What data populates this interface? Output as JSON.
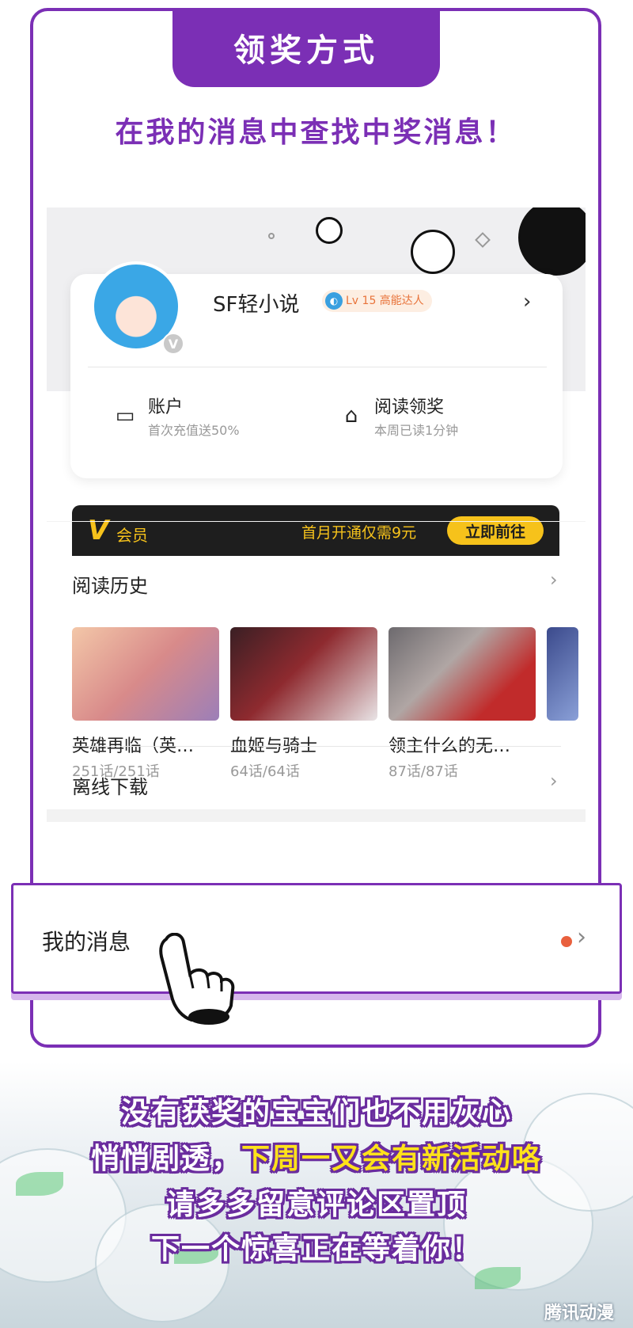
{
  "header": {
    "title": "领奖方式",
    "subtitle": "在我的消息中查找中奖消息！"
  },
  "profile": {
    "avatar_badge": "V",
    "username": "SF轻小说",
    "level_badge": "Lv 15 高能达人",
    "account": {
      "label": "账户",
      "sub": "首次充值送50%"
    },
    "reading_reward": {
      "label": "阅读领奖",
      "sub": "本周已读1分钟"
    }
  },
  "vip": {
    "logo": "V",
    "label": "会员",
    "promo": "首月开通仅需9元",
    "cta": "立即前往"
  },
  "history": {
    "title": "阅读历史",
    "books": [
      {
        "title": "英雄再临（英…",
        "count": "251话/251话",
        "cover_color": "#d88a8a"
      },
      {
        "title": "血姬与骑士",
        "count": "64话/64话",
        "cover_color": "#8e2a2f"
      },
      {
        "title": "领主什么的无…",
        "count": "87话/87话",
        "cover_color": "#6d6a6e"
      }
    ]
  },
  "offline": {
    "title": "离线下载"
  },
  "messages": {
    "title": "我的消息"
  },
  "bottom": {
    "line1": "没有获奖的宝宝们也不用灰心",
    "line2_a": "悄悄剧透，",
    "line2_b": "下周一又会有新活动咯",
    "line3": "请多多留意评论区置顶",
    "line4": "下一个惊喜正在等着你！",
    "watermark": "腾讯动漫"
  },
  "colors": {
    "accent": "#7b2fb5",
    "vip_gold": "#f6c21b",
    "notify_dot": "#e9603d"
  }
}
